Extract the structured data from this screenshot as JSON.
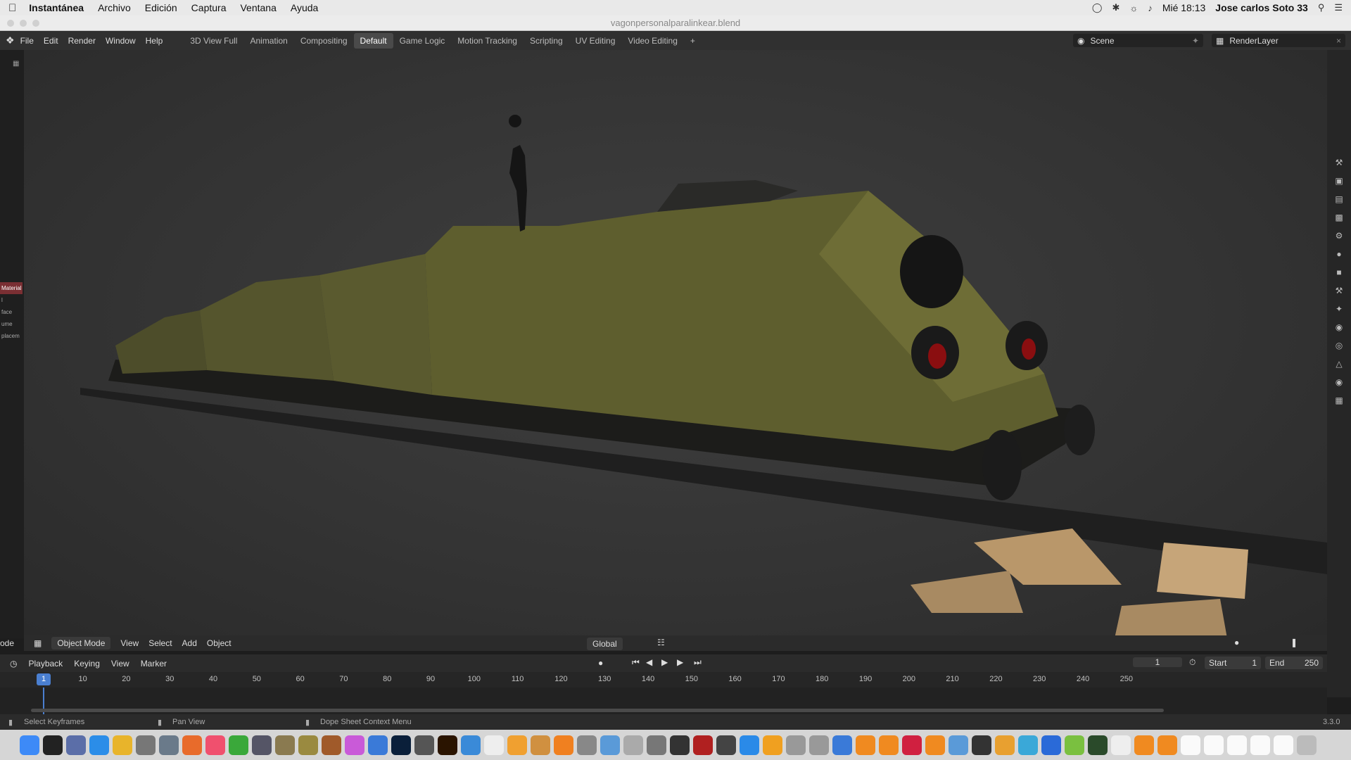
{
  "mac_menubar": {
    "app_name": "Instantánea",
    "menus": [
      "Archivo",
      "Edición",
      "Captura",
      "Ventana",
      "Ayuda"
    ],
    "clock": "Mié 18:13",
    "user": "Jose carlos Soto 33"
  },
  "window": {
    "title": "vagonpersonalparalinkear.blend"
  },
  "topbar": {
    "menus": [
      "File",
      "Edit",
      "Render",
      "Window",
      "Help"
    ],
    "workspaces": [
      "3D View Full",
      "Animation",
      "Compositing",
      "Default",
      "Game Logic",
      "Motion Tracking",
      "Scripting",
      "UV Editing",
      "Video Editing"
    ],
    "active_workspace": "Default",
    "add_workspace": "+",
    "scene_name": "Scene",
    "render_layer": "RenderLayer"
  },
  "left_panel": {
    "items": [
      "Material",
      "l",
      "face",
      "ume",
      "placem"
    ]
  },
  "viewport_header": {
    "mode_label": "ode",
    "object_mode": "Object Mode",
    "menus": [
      "View",
      "Select",
      "Add",
      "Object"
    ],
    "transform_orientation": "Global"
  },
  "timeline": {
    "menus": [
      "Playback",
      "Keying",
      "View",
      "Marker"
    ],
    "current_frame": "1",
    "start_label": "Start",
    "start_value": "1",
    "end_label": "End",
    "end_value": "250",
    "ruler_marks": [
      "1",
      "10",
      "20",
      "30",
      "40",
      "50",
      "60",
      "70",
      "80",
      "90",
      "100",
      "110",
      "120",
      "130",
      "140",
      "150",
      "160",
      "170",
      "180",
      "190",
      "200",
      "210",
      "220",
      "230",
      "240",
      "250"
    ]
  },
  "status_bar": {
    "select": "Select Keyframes",
    "pan": "Pan View",
    "context": "Dope Sheet Context Menu",
    "version": "3.3.0"
  },
  "colors": {
    "train_olive": "#5a5a2c",
    "selected_frame": "#4a7fd0",
    "active_material": "#7a2f33"
  }
}
